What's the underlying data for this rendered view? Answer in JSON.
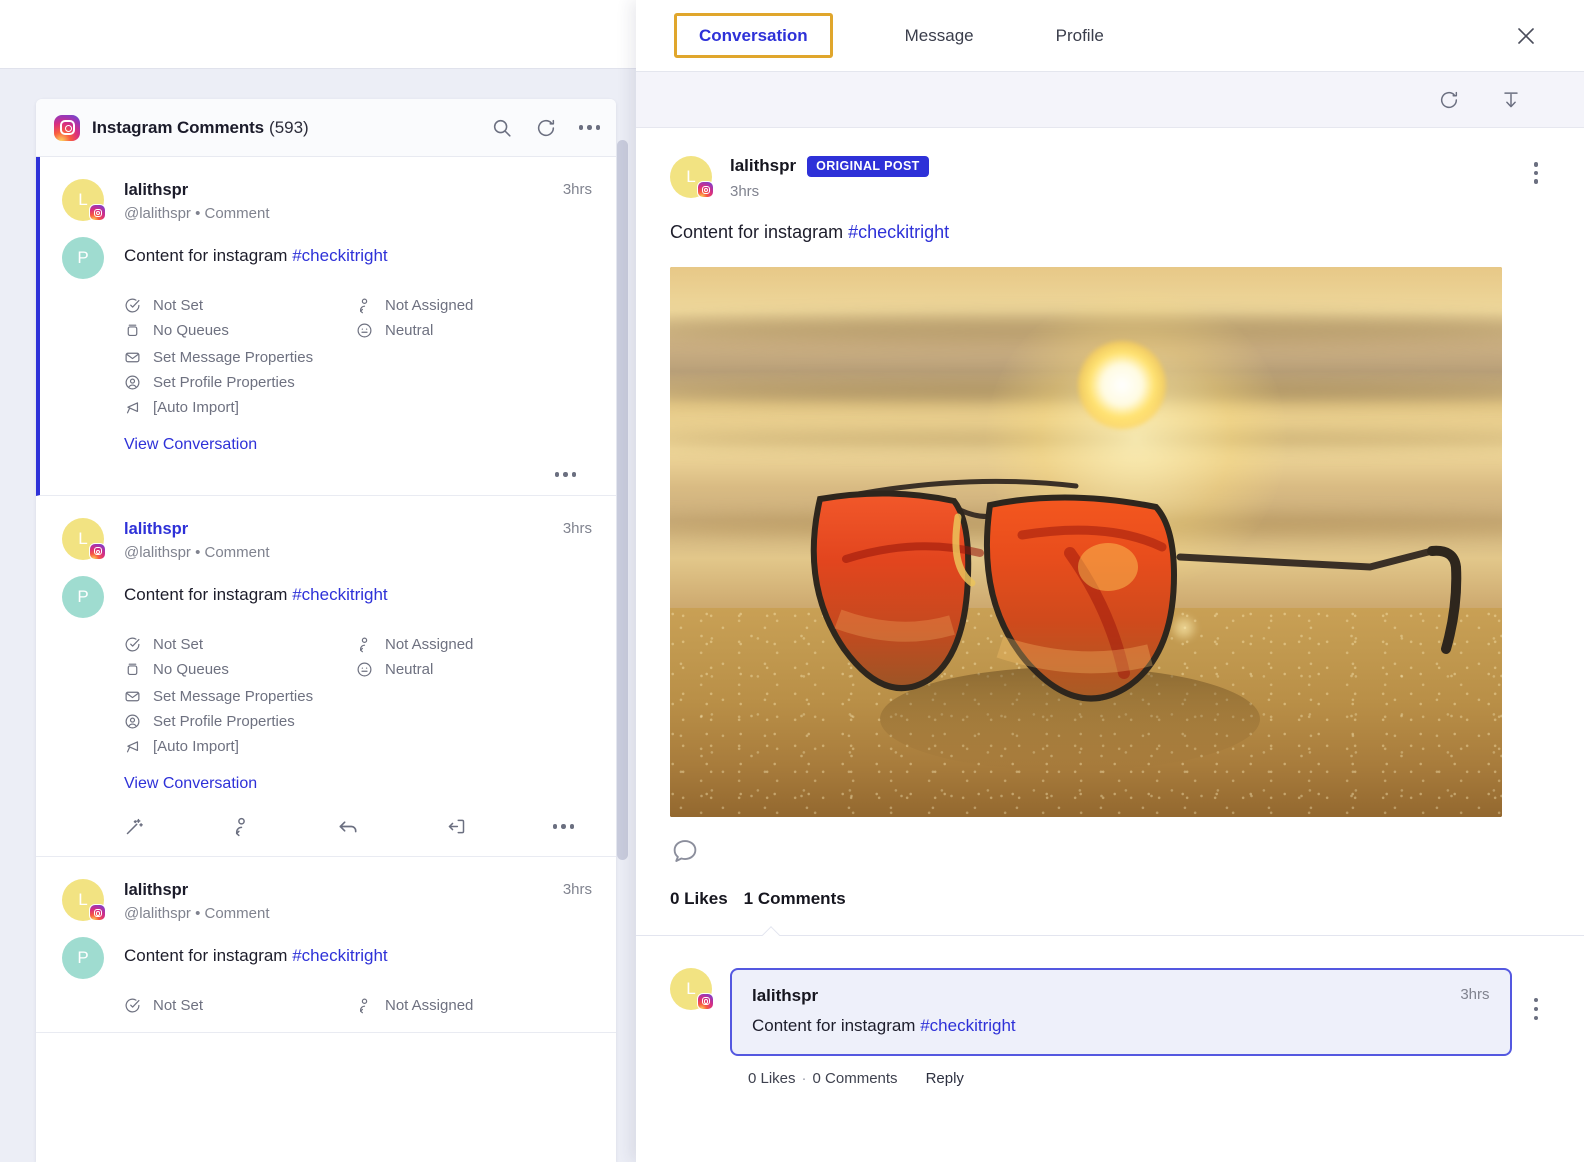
{
  "left": {
    "header": {
      "logo_icon": "instagram-icon",
      "title": "Instagram Comments",
      "count": "(593)",
      "search_icon": "search-icon",
      "refresh_icon": "refresh-icon",
      "more_icon": "more-horizontal-icon"
    },
    "items": [
      {
        "avatar_letter": "L",
        "avatar_letter_2": "P",
        "username": "lalithspr",
        "handle": "@lalithspr • Comment",
        "time": "3hrs",
        "message_text": "Content for instagram ",
        "message_hashtag": "#checkitright",
        "meta": {
          "due": "Not Set",
          "assignee": "Not Assigned",
          "queue": "No Queues",
          "sentiment": "Neutral",
          "message_properties": "Set Message Properties",
          "profile_properties": "Set Profile Properties",
          "source": "[Auto Import]"
        },
        "view_conversation": "View Conversation",
        "selected": true,
        "username_is_link": false
      },
      {
        "avatar_letter": "L",
        "avatar_letter_2": "P",
        "username": "lalithspr",
        "handle": "@lalithspr • Comment",
        "time": "3hrs",
        "message_text": "Content for instagram ",
        "message_hashtag": "#checkitright",
        "meta": {
          "due": "Not Set",
          "assignee": "Not Assigned",
          "queue": "No Queues",
          "sentiment": "Neutral",
          "message_properties": "Set Message Properties",
          "profile_properties": "Set Profile Properties",
          "source": "[Auto Import]"
        },
        "view_conversation": "View Conversation",
        "selected": false,
        "username_is_link": true
      },
      {
        "avatar_letter": "L",
        "avatar_letter_2": "P",
        "username": "lalithspr",
        "handle": "@lalithspr • Comment",
        "time": "3hrs",
        "message_text": "Content for instagram ",
        "message_hashtag": "#checkitright",
        "meta": {
          "due": "Not Set",
          "assignee": "Not Assigned"
        },
        "selected": false,
        "username_is_link": false
      }
    ],
    "item_action_icons": [
      "magic-wand-icon",
      "assign-user-icon",
      "reply-arrow-icon",
      "exit-icon",
      "more-horizontal-icon"
    ]
  },
  "right": {
    "tabs": [
      {
        "label": "Conversation",
        "active": true
      },
      {
        "label": "Message",
        "active": false
      },
      {
        "label": "Profile",
        "active": false
      }
    ],
    "close_icon": "close-icon",
    "toolbar": {
      "refresh_icon": "refresh-icon",
      "scroll_to_bottom_icon": "scroll-to-bottom-icon"
    },
    "original_post": {
      "avatar_letter": "L",
      "username": "lalithspr",
      "badge": "ORIGINAL POST",
      "time": "3hrs",
      "text": "Content for instagram ",
      "hashtag": "#checkitright",
      "menu_icon": "more-vertical-icon",
      "photo_alt": "aviator-sunglasses-on-sand-at-sunset",
      "comment_icon": "comment-bubble-icon",
      "likes": "0 Likes",
      "comments": "1 Comments"
    },
    "reply": {
      "avatar_letter": "L",
      "username": "lalithspr",
      "time": "3hrs",
      "text": "Content for instagram ",
      "hashtag": "#checkitright",
      "likes": "0 Likes",
      "separator": "·",
      "comments": "0 Comments",
      "reply_label": "Reply",
      "menu_icon": "more-vertical-icon"
    }
  },
  "colors": {
    "accent_blue": "#2e31d8",
    "highlight_gold": "#e0a62c",
    "avatar_yellow": "#f2e382",
    "avatar_teal": "#9fdcd0",
    "page_bg": "#eceef6",
    "reply_card_bg": "#eef0fa"
  }
}
